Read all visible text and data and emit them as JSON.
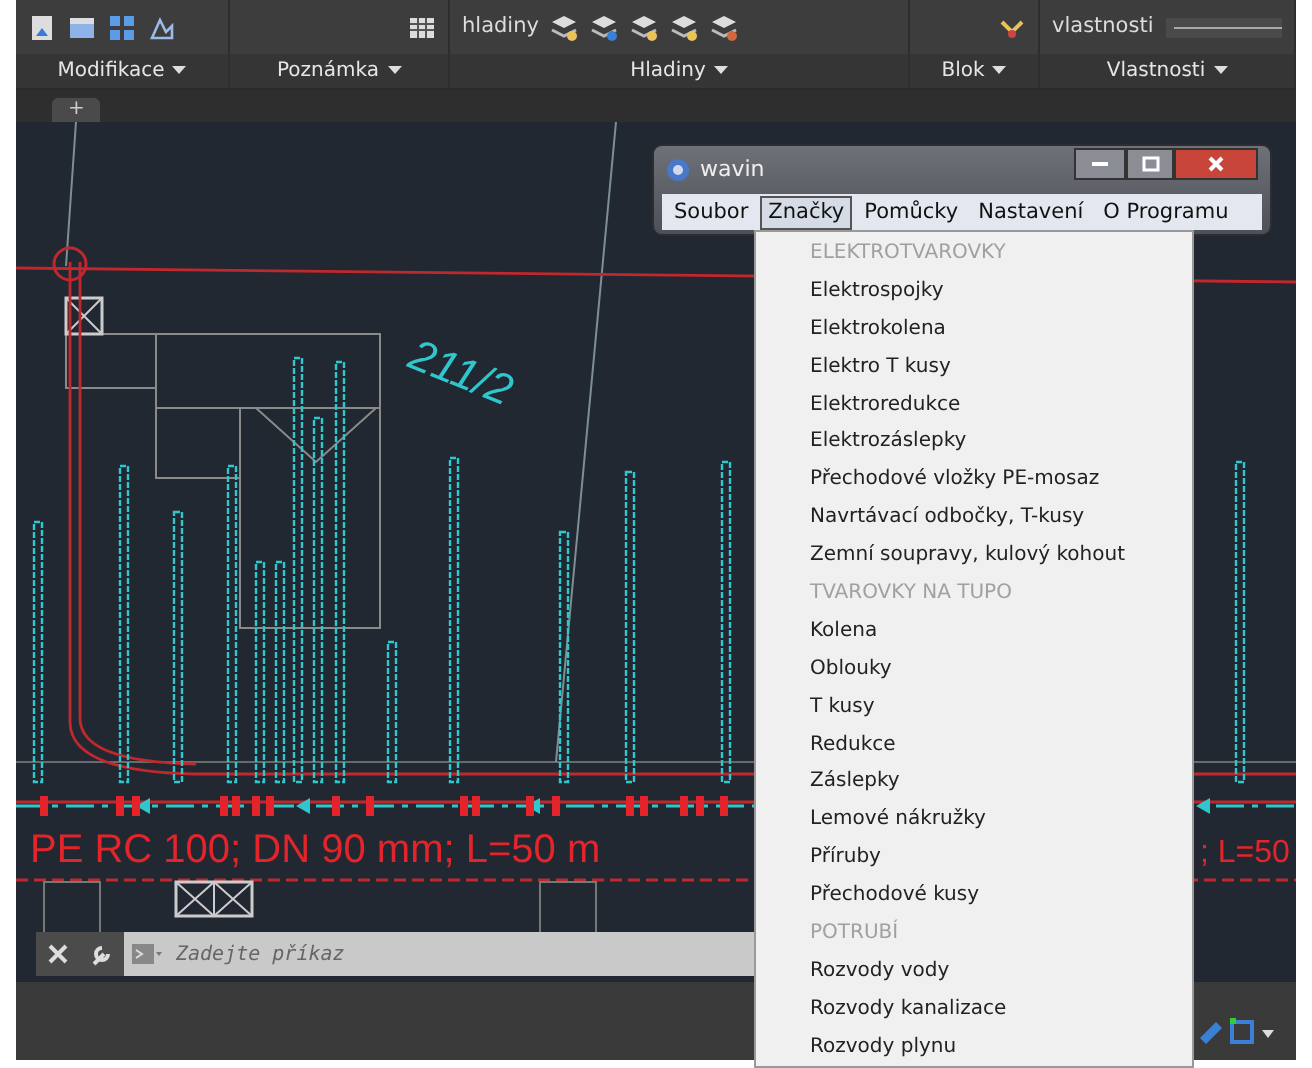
{
  "ribbon": {
    "panels": [
      {
        "label": "Modifikace"
      },
      {
        "label": "Poznámka"
      },
      {
        "label": "Hladiny",
        "texts": [
          "hladiny"
        ]
      },
      {
        "label": "Blok"
      },
      {
        "label": "Vlastnosti",
        "texts": [
          "vlastnosti"
        ]
      }
    ]
  },
  "new_tab_button": "+",
  "drawing": {
    "parcel_label": "211/2",
    "pipe_label": "PE RC 100; DN 90 mm; L=50 m",
    "pipe_label_right": "; L=50"
  },
  "command_line": {
    "placeholder": "Zadejte příkaz"
  },
  "window": {
    "title": "wavin",
    "menu": [
      {
        "label": "Soubor",
        "selected": false
      },
      {
        "label": "Značky",
        "selected": true
      },
      {
        "label": "Pomůcky",
        "selected": false
      },
      {
        "label": "Nastavení",
        "selected": false
      },
      {
        "label": "O Programu",
        "selected": false
      }
    ],
    "dropdown": [
      {
        "kind": "header",
        "label": "ELEKTROTVAROVKY"
      },
      {
        "kind": "item",
        "label": "Elektrospojky"
      },
      {
        "kind": "item",
        "label": "Elektrokolena"
      },
      {
        "kind": "item",
        "label": "Elektro T kusy"
      },
      {
        "kind": "item",
        "label": "Elektroredukce"
      },
      {
        "kind": "item",
        "label": "Elektrozáslepky"
      },
      {
        "kind": "item",
        "label": "Přechodové vložky PE-mosaz"
      },
      {
        "kind": "item",
        "label": "Navrtávací odbočky, T-kusy"
      },
      {
        "kind": "item",
        "label": "Zemní soupravy, kulový kohout"
      },
      {
        "kind": "header",
        "label": "TVAROVKY NA TUPO"
      },
      {
        "kind": "item",
        "label": "Kolena"
      },
      {
        "kind": "item",
        "label": "Oblouky"
      },
      {
        "kind": "item",
        "label": "T kusy"
      },
      {
        "kind": "item",
        "label": "Redukce"
      },
      {
        "kind": "item",
        "label": "Záslepky"
      },
      {
        "kind": "item",
        "label": "Lemové nákružky"
      },
      {
        "kind": "item",
        "label": "Příruby"
      },
      {
        "kind": "item",
        "label": "Přechodové kusy"
      },
      {
        "kind": "header",
        "label": "POTRUBÍ"
      },
      {
        "kind": "item",
        "label": "Rozvody vody"
      },
      {
        "kind": "item",
        "label": "Rozvody kanalizace"
      },
      {
        "kind": "item",
        "label": "Rozvody plynu"
      }
    ]
  }
}
